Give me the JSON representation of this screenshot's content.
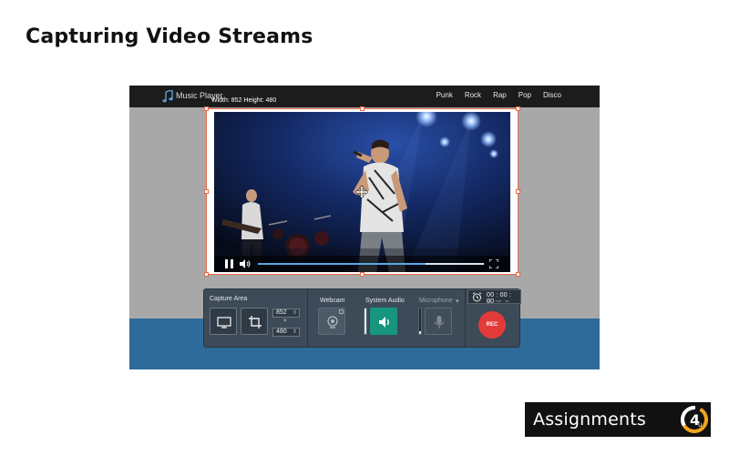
{
  "slide": {
    "title": "Capturing Video Streams"
  },
  "app": {
    "name": "Music Player",
    "nav": [
      "Punk",
      "Rock",
      "Rap",
      "Pop",
      "Disco"
    ]
  },
  "capture_region": {
    "dimensions_label": "Width: 852   Height: 480"
  },
  "player": {
    "progress_fraction": 0.74
  },
  "recorder": {
    "capture_area_label": "Capture Area",
    "width_value": "852",
    "height_value": "480",
    "times_symbol": "×",
    "webcam_label": "Webcam",
    "system_audio_label": "System Audio",
    "microphone_label": "Microphone",
    "microphone_arrow": "▾",
    "timer": "00 : 00 : 00",
    "timer_units": "hh mm ss",
    "rec_label": "REC",
    "colors": {
      "panel": "#3d4a57",
      "audio_active": "#17957f",
      "rec": "#e23b3a",
      "selection": "#e46a4a"
    }
  },
  "logo": {
    "text": "Assignments",
    "badge": "4",
    "badge_sub": "u"
  }
}
